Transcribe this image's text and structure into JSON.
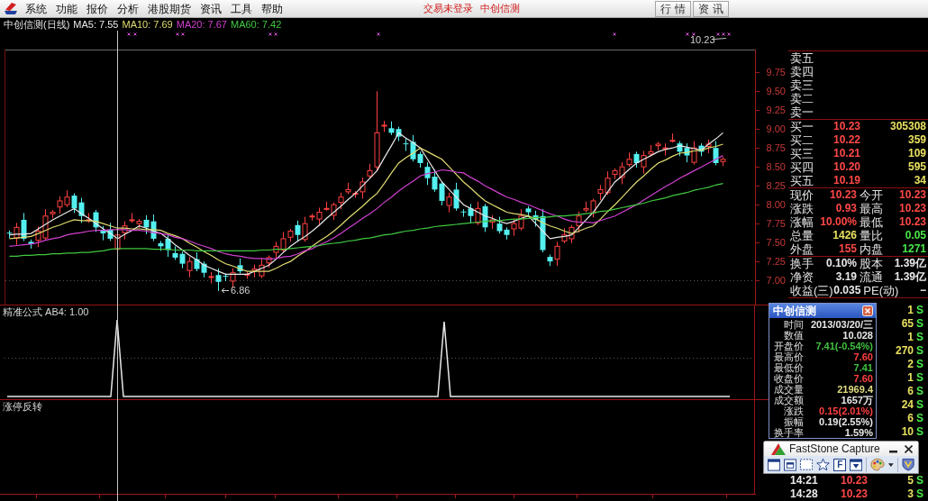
{
  "menu_bar": {
    "items": [
      "系统",
      "功能",
      "报价",
      "分析",
      "港股期货",
      "资讯",
      "工具",
      "帮助"
    ],
    "login_status": "交易未登录",
    "stock_name": "中创信测",
    "buttons": [
      "行 情",
      "资 讯"
    ]
  },
  "chart": {
    "title": "中创信测(日线)",
    "high_label": "10.23",
    "low_label": "6.86",
    "chart_data": {
      "type": "candlestick",
      "ylim": [
        6.68,
        10.05
      ],
      "yticks": [
        {
          "value": 9.75,
          "label": "9.75"
        },
        {
          "value": 9.5,
          "label": "9.50"
        },
        {
          "value": 9.25,
          "label": "9.25"
        },
        {
          "value": 9,
          "label": "9.00"
        },
        {
          "value": 8.75,
          "label": "8.75"
        },
        {
          "value": 8.5,
          "label": "8.50"
        },
        {
          "value": 8.25,
          "label": "8.25"
        },
        {
          "value": 8,
          "label": "8.00"
        },
        {
          "value": 7.75,
          "label": "7.75"
        },
        {
          "value": 7.5,
          "label": "7.50"
        },
        {
          "value": 7.25,
          "label": "7.25"
        },
        {
          "value": 7,
          "label": "7.00"
        }
      ],
      "categories": [
        null,
        null,
        null,
        null,
        null,
        null,
        null,
        null,
        null,
        null,
        null,
        null,
        null,
        null,
        null,
        null,
        null,
        null,
        null,
        null,
        null,
        null,
        null,
        null,
        null,
        null,
        null,
        null,
        null,
        null,
        null,
        null,
        null,
        null,
        null,
        null,
        null,
        null,
        null,
        null,
        null,
        null,
        null,
        null,
        null,
        null,
        null,
        null,
        null,
        null,
        null,
        null,
        null,
        null,
        null,
        null,
        null,
        null,
        null,
        null,
        null,
        null,
        null,
        null,
        null,
        null,
        null,
        null,
        null,
        null,
        null,
        null,
        null,
        null,
        null,
        null,
        null,
        null,
        null,
        null,
        null,
        null,
        null,
        null,
        null,
        null,
        null,
        null,
        null,
        null,
        null,
        null,
        null,
        null,
        null,
        null,
        null,
        null,
        null,
        null,
        null,
        null,
        null,
        null
      ],
      "ohlc": [
        [
          7.63,
          7.66,
          7.56,
          7.62
        ],
        [
          7.56,
          7.76,
          7.47,
          7.7
        ],
        [
          7.8,
          7.89,
          7.52,
          7.55
        ],
        [
          7.51,
          7.54,
          7.42,
          7.48
        ],
        [
          7.53,
          7.71,
          7.44,
          7.65
        ],
        [
          7.56,
          7.94,
          7.53,
          7.85
        ],
        [
          7.88,
          7.93,
          7.82,
          7.9
        ],
        [
          7.97,
          8.11,
          7.88,
          8.05
        ],
        [
          8.0,
          8.19,
          7.97,
          8.1
        ],
        [
          8.12,
          8.15,
          7.89,
          7.95
        ],
        [
          8.03,
          8.09,
          7.76,
          7.85
        ],
        [
          7.79,
          7.89,
          7.76,
          7.8
        ],
        [
          7.9,
          7.93,
          7.64,
          7.7
        ],
        [
          7.66,
          7.72,
          7.53,
          7.62
        ],
        [
          7.67,
          7.76,
          7.52,
          7.55
        ],
        [
          7.41,
          7.6,
          7.41,
          7.6
        ],
        [
          7.63,
          7.78,
          7.54,
          7.72
        ],
        [
          7.79,
          7.89,
          7.76,
          7.8
        ],
        [
          7.75,
          7.81,
          7.69,
          7.78
        ],
        [
          7.8,
          7.86,
          7.61,
          7.7
        ],
        [
          7.78,
          7.87,
          7.52,
          7.55
        ],
        [
          7.49,
          7.52,
          7.39,
          7.45
        ],
        [
          7.55,
          7.61,
          7.31,
          7.4
        ],
        [
          7.36,
          7.45,
          7.27,
          7.3
        ],
        [
          7.35,
          7.38,
          7.16,
          7.22
        ],
        [
          7.13,
          7.31,
          7.04,
          7.25
        ],
        [
          7.28,
          7.37,
          7.12,
          7.15
        ],
        [
          7.22,
          7.25,
          7.04,
          7.1
        ],
        [
          7.05,
          7.11,
          6.96,
          7.05
        ],
        [
          7.07,
          7.16,
          6.86,
          6.98
        ],
        [
          7.06,
          7.09,
          6.99,
          7.05
        ],
        [
          6.99,
          7.16,
          6.9,
          7.1
        ],
        [
          7.2,
          7.29,
          7.09,
          7.12
        ],
        [
          7.08,
          7.11,
          7.02,
          7.08
        ],
        [
          7.13,
          7.21,
          7.04,
          7.15
        ],
        [
          7.06,
          7.29,
          7.03,
          7.2
        ],
        [
          7.23,
          7.33,
          7.17,
          7.3
        ],
        [
          7.37,
          7.51,
          7.28,
          7.45
        ],
        [
          7.4,
          7.64,
          7.37,
          7.55
        ],
        [
          7.57,
          7.68,
          7.51,
          7.65
        ],
        [
          7.73,
          7.79,
          7.51,
          7.6
        ],
        [
          7.54,
          7.84,
          7.51,
          7.75
        ],
        [
          7.85,
          7.88,
          7.79,
          7.85
        ],
        [
          7.81,
          7.96,
          7.72,
          7.9
        ],
        [
          7.95,
          8.04,
          7.92,
          7.95
        ],
        [
          7.86,
          8.03,
          7.8,
          8.0
        ],
        [
          8.03,
          8.16,
          7.94,
          8.1
        ],
        [
          8.17,
          8.29,
          8.14,
          8.2
        ],
        [
          8.15,
          8.18,
          8.09,
          8.15
        ],
        [
          8.17,
          8.36,
          8.08,
          8.3
        ],
        [
          8.38,
          8.54,
          8.35,
          8.45
        ],
        [
          8.5,
          9.5,
          8.44,
          8.95
        ],
        [
          9.05,
          9.11,
          8.96,
          9.05
        ],
        [
          9.01,
          9.1,
          8.92,
          8.95
        ],
        [
          9.0,
          9.03,
          8.84,
          8.9
        ],
        [
          8.81,
          8.87,
          8.71,
          8.8
        ],
        [
          8.83,
          8.92,
          8.57,
          8.6
        ],
        [
          8.67,
          8.7,
          8.49,
          8.55
        ],
        [
          8.5,
          8.56,
          8.26,
          8.35
        ],
        [
          8.37,
          8.46,
          8.17,
          8.2
        ],
        [
          8.28,
          8.31,
          7.99,
          8.05
        ],
        [
          7.99,
          8.16,
          7.9,
          8.1
        ],
        [
          8.2,
          8.29,
          7.92,
          7.95
        ],
        [
          7.91,
          7.94,
          7.84,
          7.9
        ],
        [
          7.95,
          8.01,
          7.76,
          7.85
        ],
        [
          7.76,
          8.04,
          7.73,
          7.95
        ],
        [
          7.98,
          8.01,
          7.64,
          7.7
        ],
        [
          7.77,
          7.86,
          7.68,
          7.8
        ],
        [
          7.75,
          7.84,
          7.62,
          7.65
        ],
        [
          7.67,
          7.7,
          7.54,
          7.6
        ],
        [
          7.68,
          7.81,
          7.59,
          7.75
        ],
        [
          7.69,
          7.94,
          7.66,
          7.85
        ],
        [
          7.95,
          7.98,
          7.84,
          7.9
        ],
        [
          7.86,
          7.92,
          7.71,
          7.8
        ],
        [
          7.85,
          7.94,
          7.37,
          7.4
        ],
        [
          7.31,
          7.34,
          7.19,
          7.25
        ],
        [
          7.28,
          7.51,
          7.19,
          7.45
        ],
        [
          7.52,
          7.69,
          7.49,
          7.6
        ],
        [
          7.55,
          7.73,
          7.49,
          7.7
        ],
        [
          7.72,
          7.91,
          7.63,
          7.85
        ],
        [
          7.93,
          8.04,
          7.9,
          7.95
        ],
        [
          7.89,
          8.08,
          7.83,
          8.05
        ],
        [
          8.15,
          8.26,
          8.06,
          8.2
        ],
        [
          8.16,
          8.44,
          8.13,
          8.35
        ],
        [
          8.4,
          8.48,
          8.34,
          8.45
        ],
        [
          8.36,
          8.56,
          8.27,
          8.5
        ],
        [
          8.53,
          8.69,
          8.5,
          8.6
        ],
        [
          8.67,
          8.7,
          8.49,
          8.55
        ],
        [
          8.5,
          8.71,
          8.41,
          8.65
        ],
        [
          8.67,
          8.79,
          8.64,
          8.7
        ],
        [
          8.78,
          8.83,
          8.72,
          8.8
        ],
        [
          8.74,
          8.81,
          8.65,
          8.75
        ],
        [
          8.85,
          8.94,
          8.82,
          8.85
        ],
        [
          8.81,
          8.84,
          8.64,
          8.7
        ],
        [
          8.75,
          8.81,
          8.56,
          8.65
        ],
        [
          8.56,
          8.84,
          8.53,
          8.75
        ],
        [
          8.78,
          8.81,
          8.64,
          8.7
        ],
        [
          8.77,
          8.86,
          8.68,
          8.8
        ],
        [
          8.75,
          8.84,
          8.52,
          8.55
        ],
        [
          8.57,
          8.63,
          8.51,
          8.6
        ],
        null,
        null,
        null,
        null
      ],
      "series": [
        {
          "name": "MA5: 7.55",
          "type": "line",
          "color": "#e8e8e8",
          "values": [
            7.6,
            7.61,
            7.61,
            7.62,
            7.68,
            7.74,
            7.8,
            7.85,
            7.9,
            7.95,
            7.88,
            7.82,
            7.75,
            7.68,
            7.62,
            7.55,
            7.61,
            7.66,
            7.72,
            7.69,
            7.65,
            7.62,
            7.55,
            7.47,
            7.4,
            7.33,
            7.27,
            7.2,
            7.16,
            7.12,
            7.08,
            7.08,
            7.08,
            7.08,
            7.12,
            7.16,
            7.2,
            7.28,
            7.37,
            7.45,
            7.52,
            7.58,
            7.65,
            7.73,
            7.82,
            7.9,
            7.98,
            8.07,
            8.15,
            8.25,
            8.35,
            8.45,
            8.62,
            8.78,
            8.95,
            8.88,
            8.82,
            8.75,
            8.6,
            8.45,
            8.3,
            8.2,
            8.1,
            8.0,
            7.95,
            7.9,
            7.85,
            7.82,
            7.78,
            7.75,
            7.78,
            7.82,
            7.85,
            7.75,
            7.65,
            7.55,
            7.57,
            7.58,
            7.6,
            7.7,
            7.8,
            7.9,
            8.03,
            8.17,
            8.3,
            8.38,
            8.47,
            8.55,
            8.6,
            8.65,
            8.7,
            8.73,
            8.75,
            8.78,
            8.76,
            8.74,
            8.72,
            8.8,
            8.87,
            8.95,
            null,
            null,
            null,
            null
          ]
        },
        {
          "name": "MA10: 7.69",
          "type": "line",
          "color": "#e0dc70",
          "values": [
            7.55,
            7.56,
            7.57,
            7.58,
            7.62,
            7.66,
            7.7,
            7.73,
            7.77,
            7.8,
            7.79,
            7.79,
            7.78,
            7.75,
            7.72,
            7.69,
            7.69,
            7.68,
            7.68,
            7.67,
            7.67,
            7.66,
            7.62,
            7.59,
            7.55,
            7.49,
            7.44,
            7.38,
            7.33,
            7.27,
            7.22,
            7.19,
            7.15,
            7.12,
            7.12,
            7.12,
            7.12,
            7.16,
            7.21,
            7.25,
            7.32,
            7.38,
            7.45,
            7.52,
            7.58,
            7.65,
            7.73,
            7.82,
            7.9,
            7.98,
            8.07,
            8.15,
            8.28,
            8.42,
            8.55,
            8.62,
            8.68,
            8.75,
            8.7,
            8.65,
            8.6,
            8.5,
            8.4,
            8.3,
            8.22,
            8.13,
            8.05,
            8.0,
            7.95,
            7.9,
            7.88,
            7.87,
            7.85,
            7.81,
            7.76,
            7.72,
            7.69,
            7.65,
            7.62,
            7.65,
            7.69,
            7.72,
            7.81,
            7.91,
            8.0,
            8.1,
            8.2,
            8.3,
            8.38,
            8.47,
            8.55,
            8.59,
            8.64,
            8.68,
            8.69,
            8.71,
            8.72,
            8.75,
            8.77,
            8.8,
            null,
            null,
            null,
            null
          ]
        },
        {
          "name": "MA20: 7.67",
          "type": "line",
          "color": "#d040d0",
          "values": [
            7.45,
            7.46,
            7.47,
            7.48,
            7.5,
            7.53,
            7.55,
            7.57,
            7.6,
            7.62,
            7.63,
            7.65,
            7.66,
            7.66,
            7.67,
            7.67,
            7.67,
            7.66,
            7.66,
            7.65,
            7.63,
            7.62,
            7.6,
            7.57,
            7.55,
            7.52,
            7.48,
            7.45,
            7.42,
            7.38,
            7.35,
            7.33,
            7.32,
            7.3,
            7.29,
            7.29,
            7.28,
            7.29,
            7.31,
            7.32,
            7.35,
            7.39,
            7.42,
            7.47,
            7.51,
            7.56,
            7.62,
            7.69,
            7.75,
            7.82,
            7.88,
            7.95,
            8.03,
            8.1,
            8.18,
            8.25,
            8.31,
            8.38,
            8.41,
            8.43,
            8.46,
            8.45,
            8.43,
            8.42,
            8.36,
            8.31,
            8.25,
            8.2,
            8.15,
            8.1,
            8.07,
            8.03,
            8.0,
            7.96,
            7.92,
            7.88,
            7.85,
            7.81,
            7.78,
            7.77,
            7.77,
            7.76,
            7.79,
            7.82,
            7.85,
            7.9,
            7.95,
            8.0,
            8.06,
            8.12,
            8.18,
            8.24,
            8.29,
            8.35,
            8.4,
            8.45,
            8.5,
            8.55,
            8.6,
            8.65,
            null,
            null,
            null,
            null
          ]
        },
        {
          "name": "MA60: 7.42",
          "type": "line",
          "color": "#40c840",
          "values": [
            7.32,
            7.32,
            7.33,
            7.33,
            7.34,
            7.34,
            7.35,
            7.35,
            7.36,
            7.36,
            7.37,
            7.37,
            7.38,
            7.39,
            7.41,
            7.42,
            7.42,
            7.42,
            7.42,
            7.42,
            7.41,
            7.41,
            7.41,
            7.4,
            7.4,
            7.4,
            7.39,
            7.39,
            7.39,
            7.39,
            7.39,
            7.39,
            7.39,
            7.39,
            7.39,
            7.4,
            7.4,
            7.41,
            7.41,
            7.42,
            7.43,
            7.44,
            7.45,
            7.46,
            7.48,
            7.49,
            7.5,
            7.52,
            7.53,
            7.55,
            7.56,
            7.58,
            7.6,
            7.61,
            7.63,
            7.65,
            7.66,
            7.68,
            7.69,
            7.71,
            7.72,
            7.73,
            7.74,
            7.75,
            7.76,
            7.77,
            7.78,
            7.79,
            7.79,
            7.8,
            7.81,
            7.81,
            7.82,
            7.83,
            7.83,
            7.84,
            7.85,
            7.85,
            7.86,
            7.87,
            7.88,
            7.89,
            7.91,
            7.92,
            7.94,
            7.96,
            7.98,
            8.0,
            8.02,
            8.05,
            8.07,
            8.09,
            8.12,
            8.14,
            8.16,
            8.19,
            8.21,
            8.23,
            8.26,
            8.28,
            null,
            null,
            null,
            null
          ]
        }
      ]
    }
  },
  "formula_pane": {
    "label": "精准公式 AB4: 1.00"
  },
  "reversal_pane": {
    "label": "涨停反转"
  },
  "order_book": {
    "asks": [
      "卖五",
      "卖四",
      "卖三",
      "卖二",
      "卖一"
    ],
    "bids": [
      {
        "label": "买一",
        "price": "10.23",
        "volume": "305308"
      },
      {
        "label": "买二",
        "price": "10.22",
        "volume": "359"
      },
      {
        "label": "买三",
        "price": "10.21",
        "volume": "109"
      },
      {
        "label": "买四",
        "price": "10.20",
        "volume": "595"
      },
      {
        "label": "买五",
        "price": "10.19",
        "volume": "34"
      }
    ]
  },
  "quote": [
    {
      "cells": [
        {
          "label": "现价",
          "value": "10.23",
          "color": "#ff4848"
        },
        {
          "label": "今开",
          "value": "10.23",
          "color": "#ff4848"
        }
      ]
    },
    {
      "cells": [
        {
          "label": "涨跌",
          "value": "0.93",
          "color": "#ff4848"
        },
        {
          "label": "最高",
          "value": "10.23",
          "color": "#ff4848"
        }
      ]
    },
    {
      "cells": [
        {
          "label": "涨幅",
          "value": "10.00%",
          "color": "#ff4848"
        },
        {
          "label": "最低",
          "value": "10.23",
          "color": "#ff4848"
        }
      ]
    },
    {
      "cells": [
        {
          "label": "总量",
          "value": "1426",
          "color": "#e8e060"
        },
        {
          "label": "量比",
          "value": "0.05",
          "color": "#48e848"
        }
      ]
    },
    {
      "cells": [
        {
          "label": "外盘",
          "value": "155",
          "color": "#ff4848"
        },
        {
          "label": "内盘",
          "value": "1271",
          "color": "#48e848"
        }
      ]
    }
  ],
  "stats": [
    {
      "cells": [
        {
          "label": "换手",
          "value": "0.10%",
          "color": "#e8e8e8"
        },
        {
          "label": "股本",
          "value": "1.39亿",
          "color": "#e8e8e8"
        }
      ]
    },
    {
      "cells": [
        {
          "label": "净资",
          "value": "3.19",
          "color": "#e8e8e8"
        },
        {
          "label": "流通",
          "value": "1.39亿",
          "color": "#e8e8e8"
        }
      ]
    },
    {
      "cells": [
        {
          "label": "收益(三)",
          "value": "0.035",
          "color": "#e8e8e8"
        },
        {
          "label": "PE(动)",
          "value": "−"
        }
      ]
    }
  ],
  "ticks": [
    {
      "volume": "1",
      "side": "S"
    },
    {
      "volume": "65",
      "side": "S"
    },
    {
      "volume": "1",
      "side": "S"
    },
    {
      "volume": "270",
      "side": "S"
    },
    {
      "volume": "2",
      "side": "S"
    },
    {
      "volume": "1",
      "side": "S"
    },
    {
      "volume": "6",
      "side": "S"
    },
    {
      "volume": "24",
      "side": "S"
    },
    {
      "volume": "6",
      "side": "S"
    },
    {
      "volume": "10",
      "side": "S"
    },
    {
      "time": "14:21",
      "price": "10.23",
      "volume": "5",
      "side": "S"
    },
    {
      "time": "14:28",
      "price": "10.23",
      "volume": "3",
      "side": "S"
    }
  ],
  "popup": {
    "title": "中创信测",
    "rows": [
      {
        "label": "时间",
        "value": "2013/03/20/三",
        "color": "#e8e8e8"
      },
      {
        "label": "数值",
        "value": "10.028",
        "color": "#e8e8e8"
      },
      {
        "label": "开盘价",
        "value": "7.41(-0.54%)",
        "color": "#40c040"
      },
      {
        "label": "最高价",
        "value": "7.60",
        "color": "#ff4040"
      },
      {
        "label": "最低价",
        "value": "7.41",
        "color": "#40c040"
      },
      {
        "label": "收盘价",
        "value": "7.60",
        "color": "#ff4040"
      },
      {
        "label": "成交量",
        "value": "21969.4",
        "color": "#e0dc80"
      },
      {
        "label": "成交额",
        "value": "1657万",
        "color": "#e8e8e8"
      },
      {
        "label": "涨跌",
        "value": "0.15(2.01%)",
        "color": "#ff4040"
      },
      {
        "label": "振幅",
        "value": "0.19(2.55%)",
        "color": "#e8e8e8"
      },
      {
        "label": "换手率",
        "value": "1.59%",
        "color": "#e8e8e8"
      }
    ]
  },
  "capture_toolbar": {
    "title": "FastStone Capture",
    "letter": "F"
  }
}
